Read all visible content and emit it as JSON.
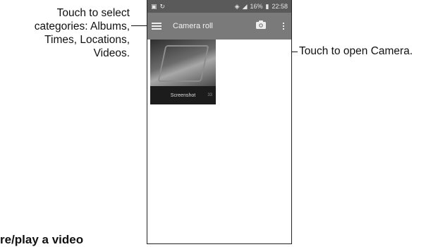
{
  "callouts": {
    "left_lines": [
      "Touch to select",
      "categories: Albums,",
      "Times,  Locations,",
      "Videos."
    ],
    "right": "Touch to open Camera."
  },
  "status_bar": {
    "battery": "16%",
    "time": "22:58",
    "left_icons": [
      "image-icon",
      "sync-icon"
    ],
    "right_icons": [
      "vibrate-icon",
      "signal-icon",
      "battery-icon"
    ]
  },
  "app_bar": {
    "title": "Camera roll",
    "menu_icon": "hamburger-menu-icon",
    "camera_icon": "camera-icon",
    "overflow_icon": "more-vert-icon"
  },
  "album": {
    "label": "Screenshot",
    "count": "33"
  },
  "bottom_heading": "re/play a video"
}
